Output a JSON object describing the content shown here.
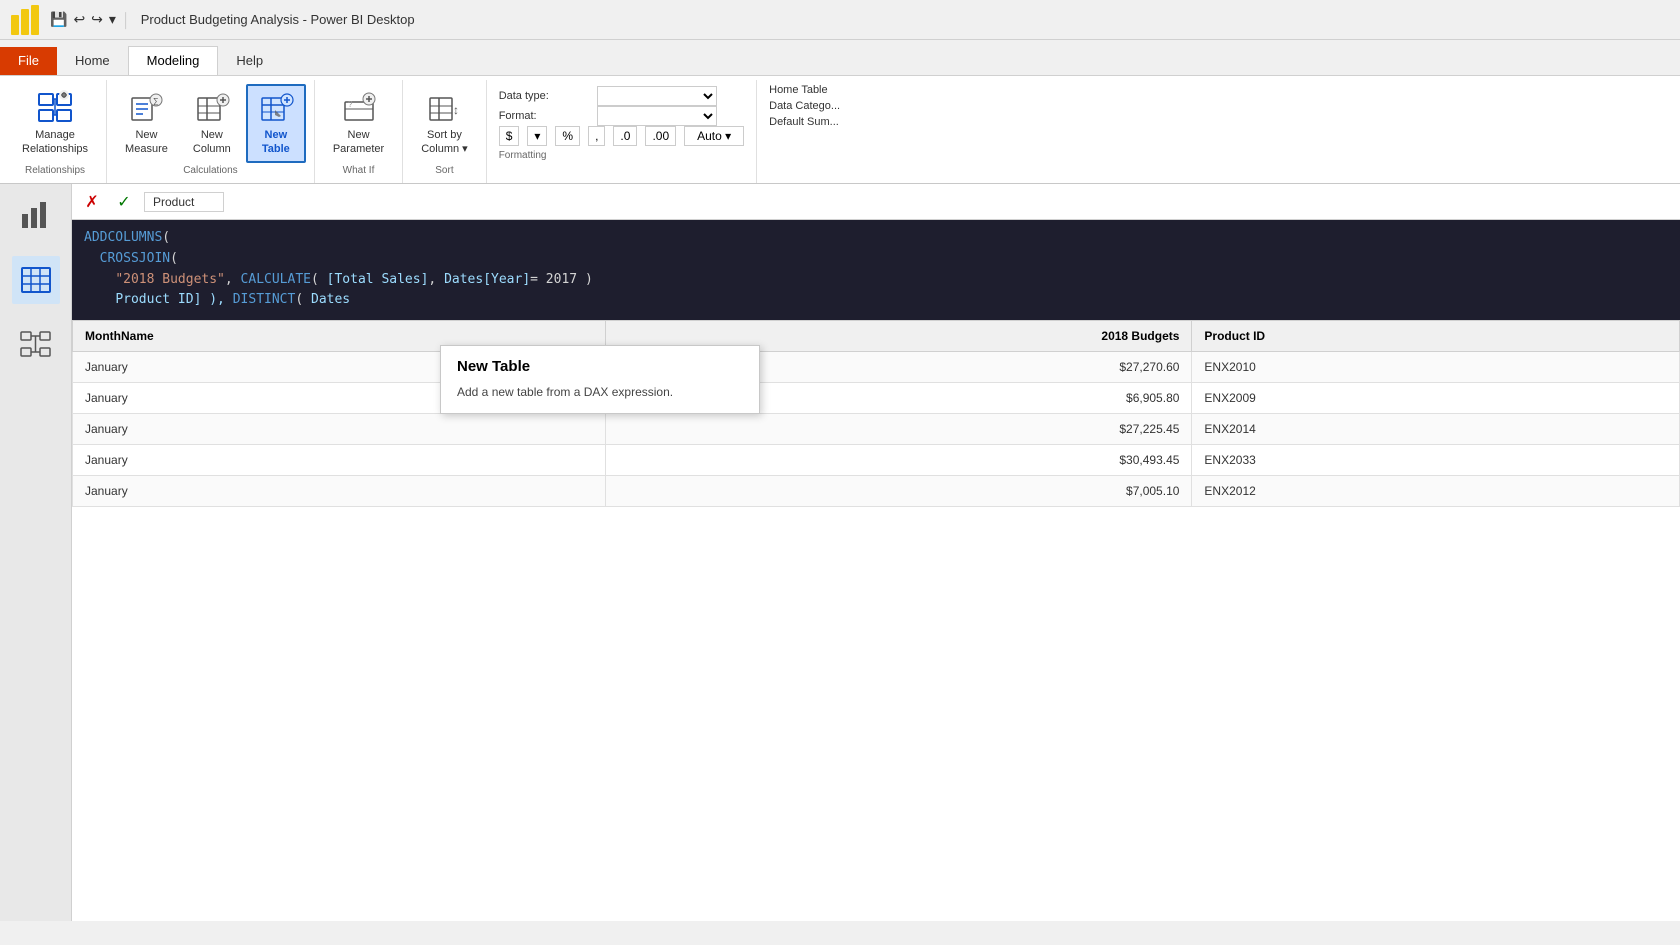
{
  "titleBar": {
    "title": "Product Budgeting Analysis - Power BI Desktop"
  },
  "ribbon": {
    "tabs": [
      {
        "id": "file",
        "label": "File",
        "active": false
      },
      {
        "id": "home",
        "label": "Home",
        "active": false
      },
      {
        "id": "modeling",
        "label": "Modeling",
        "active": true
      },
      {
        "id": "help",
        "label": "Help",
        "active": false
      }
    ],
    "groups": {
      "relationships": {
        "label": "Relationships",
        "buttons": [
          {
            "id": "manage-rel",
            "label": "Manage\nRelationships",
            "active": false
          }
        ]
      },
      "calculations": {
        "label": "Calculations",
        "buttons": [
          {
            "id": "new-measure",
            "label": "New\nMeasure",
            "active": false
          },
          {
            "id": "new-column",
            "label": "New\nColumn",
            "active": false
          },
          {
            "id": "new-table",
            "label": "New\nTable",
            "active": true
          }
        ]
      },
      "whatif": {
        "label": "What If",
        "buttons": [
          {
            "id": "new-param",
            "label": "New\nParameter",
            "active": false
          }
        ]
      },
      "sort": {
        "label": "Sort",
        "buttons": [
          {
            "id": "sort-col",
            "label": "Sort by\nColumn",
            "active": false
          }
        ]
      },
      "formatting": {
        "label": "Formatting",
        "datatype_label": "Data type:",
        "format_label": "Format:",
        "hometable_label": "Home Table",
        "datacategory_label": "Data Catego...",
        "defaultsum_label": "Default Sum...",
        "auto_label": "Auto"
      }
    }
  },
  "tooltip": {
    "title": "New Table",
    "body": "Add a new table from a DAX expression."
  },
  "formulaBar": {
    "cancelTitle": "✗",
    "confirmTitle": "✓",
    "tableName": "Product"
  },
  "daxFormula": {
    "line1": "ADDCOLUMNS(",
    "line2": "CROSSJOIN(",
    "line3_prefix": "\"2018 Budgets\", CALCULATE( [Total Sales], Dates[Year]= 2017 )",
    "columnRef": "Product ID] ), DISTINCT( Dates"
  },
  "tableData": {
    "headers": [
      "MonthName",
      "2018 Budgets",
      "Product ID"
    ],
    "rows": [
      {
        "month": "January",
        "budget": "$27,270.60",
        "productId": "ENX2010"
      },
      {
        "month": "January",
        "budget": "$6,905.80",
        "productId": "ENX2009"
      },
      {
        "month": "January",
        "budget": "$27,225.45",
        "productId": "ENX2014"
      },
      {
        "month": "January",
        "budget": "$30,493.45",
        "productId": "ENX2033"
      },
      {
        "month": "January",
        "budget": "$7,005.10",
        "productId": "ENX2012"
      }
    ]
  },
  "sidebar": {
    "items": [
      {
        "id": "report-view",
        "label": "Report view"
      },
      {
        "id": "table-view",
        "label": "Table view"
      },
      {
        "id": "model-view",
        "label": "Model view"
      }
    ]
  }
}
